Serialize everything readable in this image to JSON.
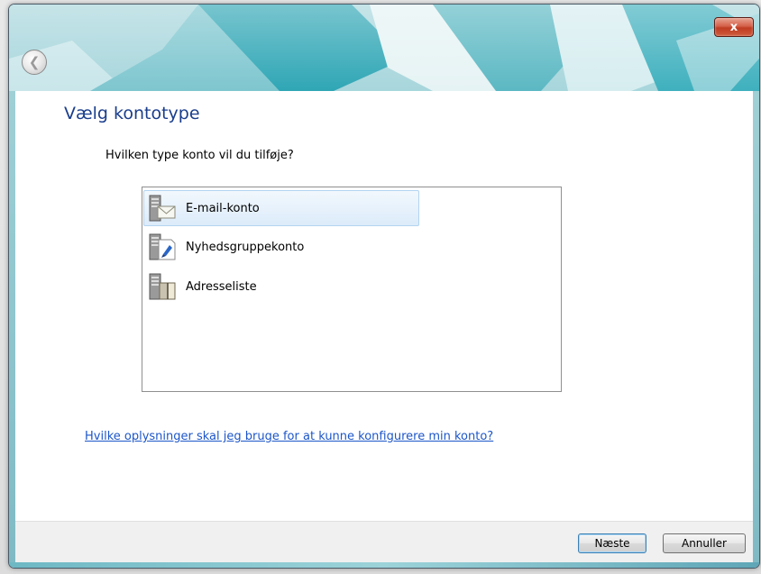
{
  "window": {
    "close_label": "x"
  },
  "page": {
    "title": "Vælg kontotype",
    "question": "Hvilken type konto vil du tilføje?"
  },
  "accounts": [
    {
      "label": "E-mail-konto",
      "icon": "email-account-icon",
      "selected": true
    },
    {
      "label": "Nyhedsgruppekonto",
      "icon": "newsgroup-account-icon",
      "selected": false
    },
    {
      "label": "Adresseliste",
      "icon": "address-book-icon",
      "selected": false
    }
  ],
  "help_link": "Hvilke oplysninger skal jeg bruge for at kunne konfigurere min konto?",
  "footer": {
    "next_label": "Næste",
    "cancel_label": "Annuller"
  },
  "colors": {
    "title_text": "#1a3e8c",
    "link_text": "#1c56c9",
    "selection_border": "#b3d4f0"
  }
}
